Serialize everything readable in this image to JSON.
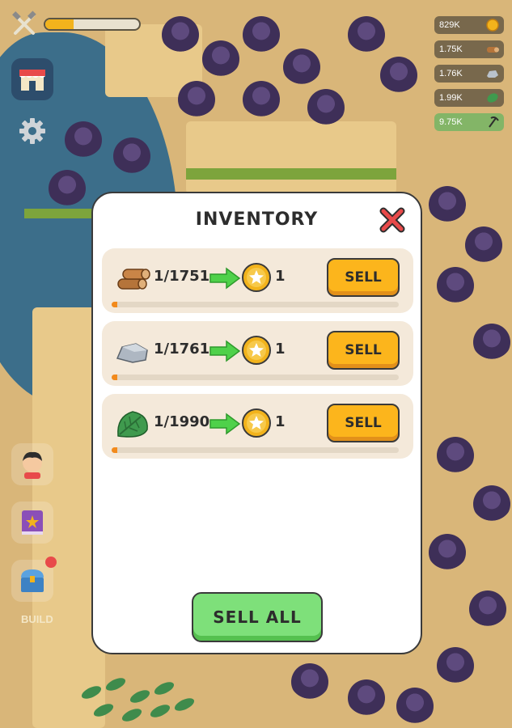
{
  "hud": {
    "xp_progress": 0.3,
    "tools_icon": "crossed-tools-icon",
    "shop_icon": "shop-icon",
    "settings_icon": "gear-icon",
    "chest_label": "BUILD",
    "resources": [
      {
        "value": "829K",
        "icon": "coin-icon"
      },
      {
        "value": "1.75K",
        "icon": "wood-log-icon"
      },
      {
        "value": "1.76K",
        "icon": "stone-icon"
      },
      {
        "value": "1.99K",
        "icon": "leaf-icon"
      },
      {
        "value": "9.75K",
        "icon": "pickaxe-icon"
      }
    ]
  },
  "inventory": {
    "title": "INVENTORY",
    "items": [
      {
        "icon": "wood-log-icon",
        "count": "1/1751",
        "reward": "1",
        "sell_label": "SELL",
        "progress": 0.02
      },
      {
        "icon": "stone-icon",
        "count": "1/1761",
        "reward": "1",
        "sell_label": "SELL",
        "progress": 0.02
      },
      {
        "icon": "leaf-icon",
        "count": "1/1990",
        "reward": "1",
        "sell_label": "SELL",
        "progress": 0.02
      }
    ],
    "sell_all_label": "SELL ALL"
  },
  "colors": {
    "sell_button": "#fcb51c",
    "sell_all_button": "#7ee07a",
    "progress_fill": "#f28a1c",
    "row_background": "#f4e9da",
    "close_x": "#e84a4a"
  }
}
